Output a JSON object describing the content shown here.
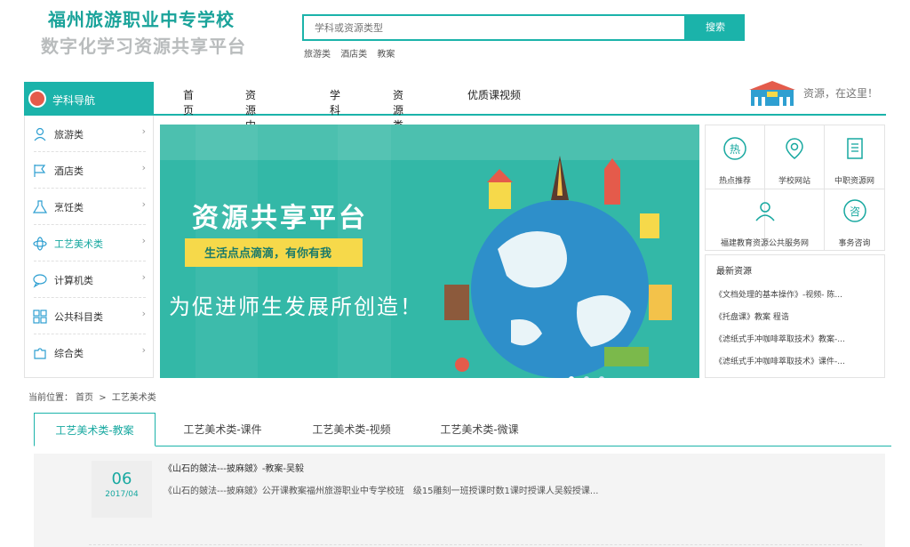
{
  "header": {
    "logo_line1": "福州旅游职业中专学校",
    "logo_line2": "数字化学习资源共享平台",
    "search_placeholder": "学科或资源类型",
    "search_button": "搜索",
    "hotwords": [
      "旅游类",
      "酒店类",
      "教案"
    ]
  },
  "nav": {
    "title": "学科导航",
    "items": [
      "首页",
      "资源中心",
      "学科",
      "资源类型",
      "优质课视频"
    ],
    "right_text": "资源，在这里！"
  },
  "sidebar": {
    "items": [
      {
        "label": "旅游类",
        "icon": "person-icon"
      },
      {
        "label": "酒店类",
        "icon": "flag-icon"
      },
      {
        "label": "烹饪类",
        "icon": "flask-icon"
      },
      {
        "label": "工艺美术类",
        "icon": "atom-icon"
      },
      {
        "label": "计算机类",
        "icon": "chat-icon"
      },
      {
        "label": "公共科目类",
        "icon": "grid-icon"
      },
      {
        "label": "综合类",
        "icon": "puzzle-icon"
      }
    ],
    "active_index": 3
  },
  "banner": {
    "title": "资源共享平台",
    "ribbon": "生活点点滴滴，有你有我",
    "slogan": "为促进师生发展所创造！"
  },
  "quick_links": [
    {
      "label": "热点推荐",
      "icon": "hot-icon"
    },
    {
      "label": "学校网站",
      "icon": "location-icon"
    },
    {
      "label": "中职资源网",
      "icon": "book-icon"
    },
    {
      "label": "福建教育资源公共服务网",
      "icon": "user-icon"
    },
    {
      "label": "事务咨询",
      "icon": "consult-icon"
    }
  ],
  "latest": {
    "heading": "最新资源",
    "items": [
      "《文档处理的基本操作》-视频- 陈...",
      "《托盘课》教案 程诰",
      "《滤纸式手冲咖啡萃取技术》教案-...",
      "《滤纸式手冲咖啡萃取技术》课件-..."
    ]
  },
  "breadcrumb": {
    "prefix": "当前位置：",
    "items": [
      "首页",
      ">",
      "工艺美术类"
    ]
  },
  "tabs": [
    "工艺美术类-教案",
    "工艺美术类-课件",
    "工艺美术类-视频",
    "工艺美术类-微课"
  ],
  "entry": {
    "day": "06",
    "year_month": "2017/04",
    "title": "《山石的皴法---披麻皴》-教案-吴毅",
    "description": "《山石的皴法---披麻皴》公开课教案福州旅游职业中专学校班　级15雕刻一班授课时数1课时授课人吴毅授课..."
  },
  "colors": {
    "accent": "#1bb3aa",
    "logo_teal": "#1aa39a",
    "logo_grey": "#b9bcbd"
  }
}
